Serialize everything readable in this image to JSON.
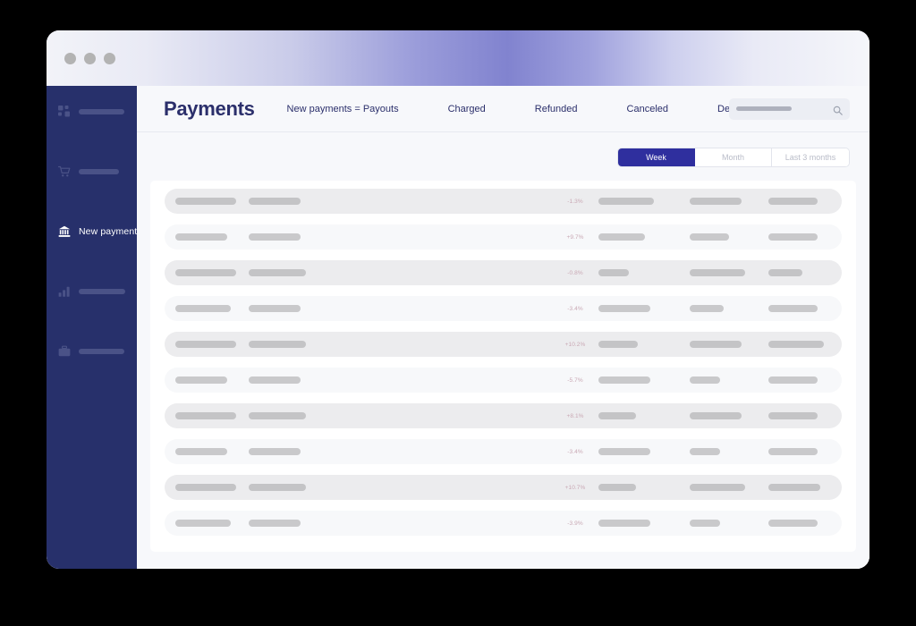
{
  "window": {
    "traffic_lights": [
      "close",
      "minimize",
      "maximize"
    ]
  },
  "sidebar": {
    "items": [
      {
        "icon": "grid-icon",
        "label": "",
        "active": false,
        "ghost_width": 51
      },
      {
        "icon": "cart-icon",
        "label": "",
        "active": false,
        "ghost_width": 45
      },
      {
        "icon": "bank-icon",
        "label": "New payments",
        "active": true,
        "ghost_width": 0
      },
      {
        "icon": "bar-chart-icon",
        "label": "",
        "active": false,
        "ghost_width": 52
      },
      {
        "icon": "briefcase-icon",
        "label": "",
        "active": false,
        "ghost_width": 51
      }
    ]
  },
  "header": {
    "title": "Payments",
    "tabs": [
      {
        "label": "New payments = Payouts"
      },
      {
        "label": "Charged"
      },
      {
        "label": "Refunded"
      },
      {
        "label": "Canceled"
      },
      {
        "label": "Declined"
      }
    ],
    "search": {
      "placeholder": "",
      "value": "",
      "icon": "search-icon"
    }
  },
  "range_filter": {
    "options": [
      {
        "label": "Week",
        "active": true
      },
      {
        "label": "Month",
        "active": false
      },
      {
        "label": "Last 3 months",
        "active": false
      }
    ]
  },
  "table": {
    "rows": [
      {
        "style": "alt",
        "change": "-1.3%",
        "w1": 68,
        "w2": 58,
        "w3": 62,
        "w4": 58,
        "w5": 55
      },
      {
        "style": "plain",
        "change": "+9.7%",
        "w1": 58,
        "w2": 58,
        "w3": 52,
        "w4": 44,
        "w5": 55
      },
      {
        "style": "alt",
        "change": "-0.8%",
        "w1": 68,
        "w2": 64,
        "w3": 34,
        "w4": 62,
        "w5": 38
      },
      {
        "style": "plain",
        "change": "-3.4%",
        "w1": 62,
        "w2": 58,
        "w3": 58,
        "w4": 38,
        "w5": 55
      },
      {
        "style": "alt",
        "change": "+10.2%",
        "w1": 68,
        "w2": 64,
        "w3": 44,
        "w4": 58,
        "w5": 62
      },
      {
        "style": "plain",
        "change": "-5.7%",
        "w1": 58,
        "w2": 58,
        "w3": 58,
        "w4": 34,
        "w5": 55
      },
      {
        "style": "alt",
        "change": "+8.1%",
        "w1": 68,
        "w2": 64,
        "w3": 42,
        "w4": 58,
        "w5": 55
      },
      {
        "style": "plain",
        "change": "-3.4%",
        "w1": 58,
        "w2": 58,
        "w3": 58,
        "w4": 34,
        "w5": 55
      },
      {
        "style": "alt",
        "change": "+10.7%",
        "w1": 68,
        "w2": 64,
        "w3": 42,
        "w4": 62,
        "w5": 58
      },
      {
        "style": "plain",
        "change": "-3.9%",
        "w1": 62,
        "w2": 58,
        "w3": 58,
        "w4": 34,
        "w5": 55
      }
    ]
  },
  "colors": {
    "sidebar_bg": "#27306b",
    "accent": "#2f2f9e",
    "title_gradient_peak": "#8183cf",
    "page_bg": "#f7f8fb",
    "skeleton": "#c4c4c6",
    "change_text": "#c9a8b4",
    "heading": "#2b2f6b"
  }
}
